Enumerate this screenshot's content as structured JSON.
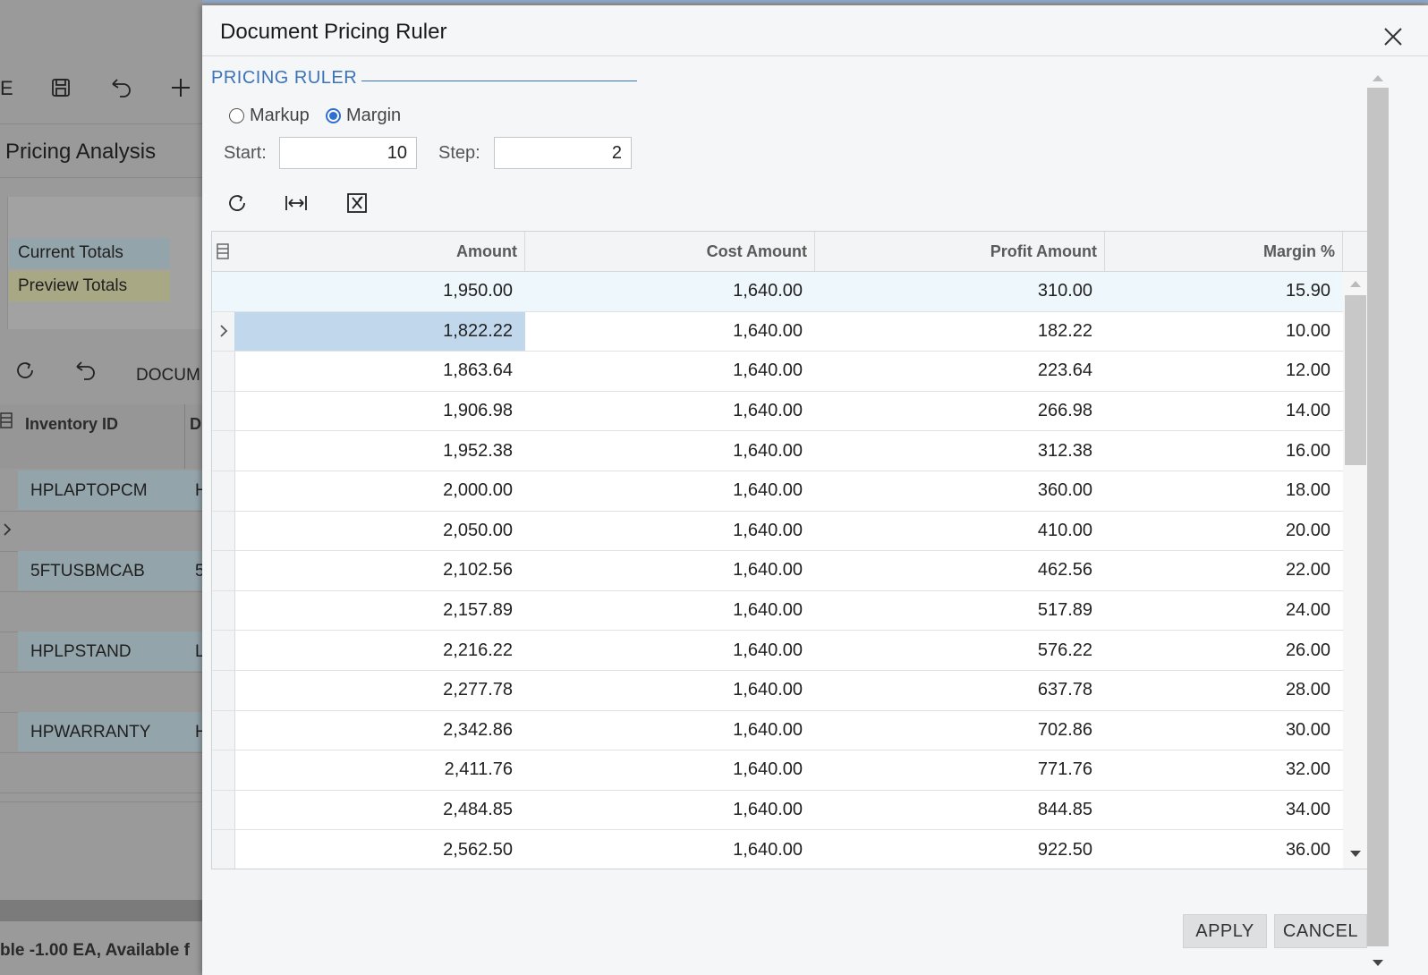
{
  "background": {
    "toolbar": {
      "partial_label": "E",
      "save_icon": "save-icon",
      "undo_icon": "undo-icon",
      "add_icon": "plus-icon"
    },
    "page_title": "Pricing Analysis",
    "totals": {
      "current": "Current Totals",
      "preview": "Preview Totals"
    },
    "grid_toolbar": {
      "refresh_icon": "refresh-icon",
      "undo_icon": "undo-icon",
      "document_label": "DOCUM"
    },
    "grid": {
      "columns": [
        "Inventory ID",
        "D"
      ],
      "rows": [
        {
          "inventory_id": "HPLAPTOPCM",
          "desc": "H"
        },
        {
          "inventory_id": "5FTUSBMCAB",
          "desc": "5"
        },
        {
          "inventory_id": "HPLPSTAND",
          "desc": "L"
        },
        {
          "inventory_id": "HPWARRANTY",
          "desc": "H"
        }
      ]
    },
    "status_text": "ble -1.00 EA, Available f"
  },
  "dialog": {
    "title": "Document Pricing Ruler",
    "close_icon": "close-icon",
    "section_title": "PRICING RULER",
    "mode_options": [
      {
        "label": "Markup",
        "selected": false
      },
      {
        "label": "Margin",
        "selected": true
      }
    ],
    "start": {
      "label": "Start:",
      "value": "10"
    },
    "step": {
      "label": "Step:",
      "value": "2"
    },
    "toolbar_icons": [
      "refresh-icon",
      "fit-width-icon",
      "excel-export-icon"
    ],
    "columns": [
      "Amount",
      "Cost Amount",
      "Profit Amount",
      "Margin %"
    ],
    "rows": [
      [
        "1,950.00",
        "1,640.00",
        "310.00",
        "15.90"
      ],
      [
        "1,822.22",
        "1,640.00",
        "182.22",
        "10.00"
      ],
      [
        "1,863.64",
        "1,640.00",
        "223.64",
        "12.00"
      ],
      [
        "1,906.98",
        "1,640.00",
        "266.98",
        "14.00"
      ],
      [
        "1,952.38",
        "1,640.00",
        "312.38",
        "16.00"
      ],
      [
        "2,000.00",
        "1,640.00",
        "360.00",
        "18.00"
      ],
      [
        "2,050.00",
        "1,640.00",
        "410.00",
        "20.00"
      ],
      [
        "2,102.56",
        "1,640.00",
        "462.56",
        "22.00"
      ],
      [
        "2,157.89",
        "1,640.00",
        "517.89",
        "24.00"
      ],
      [
        "2,216.22",
        "1,640.00",
        "576.22",
        "26.00"
      ],
      [
        "2,277.78",
        "1,640.00",
        "637.78",
        "28.00"
      ],
      [
        "2,342.86",
        "1,640.00",
        "702.86",
        "30.00"
      ],
      [
        "2,411.76",
        "1,640.00",
        "771.76",
        "32.00"
      ],
      [
        "2,484.85",
        "1,640.00",
        "844.85",
        "34.00"
      ],
      [
        "2,562.50",
        "1,640.00",
        "922.50",
        "36.00"
      ]
    ],
    "active_row": 1,
    "buttons": {
      "apply": "APPLY",
      "cancel": "CANCEL"
    },
    "colors": {
      "accent": "#3b73b9",
      "highlight_row": "#eef7fb",
      "active_cell": "#c1d7ec"
    }
  }
}
